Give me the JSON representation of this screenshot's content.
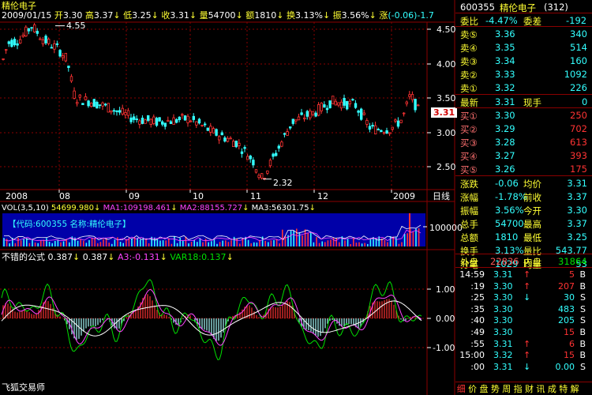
{
  "stock": {
    "name": "精伦电子",
    "code": "600355",
    "title_right": "精伦电子",
    "code_paren": "(312)"
  },
  "quote_bar": {
    "date": "2009/01/15",
    "open_label": "开",
    "open": "3.30",
    "high_label": "高",
    "high": "3.37",
    "low_label": "低",
    "low": "3.25",
    "close_label": "收",
    "close": "3.31",
    "vol_label": "量",
    "vol": "54700",
    "amt_label": "额",
    "amt": "1810",
    "turn_label": "换",
    "turn": "3.13%",
    "amp_label": "振",
    "amp": "3.56%",
    "chg_label": "涨",
    "chg": "(-0.06)-1.7"
  },
  "price_chart": {
    "y_ticks": [
      "4.50",
      "4.00",
      "3.50",
      "3.00",
      "2.50"
    ],
    "x_ticks": [
      "2008",
      "08",
      "09",
      "10",
      "11",
      "12",
      "2009"
    ],
    "x_axis_name": "日线",
    "current_price": "3.31",
    "high_marker": "4.55",
    "low_marker": "2.32"
  },
  "vol_header": {
    "label": "VOL(3,5,10)",
    "v1": "54699.980",
    "v1_label": "MA1:",
    "ma1": "109198.461",
    "ma2_label": "MA2:",
    "ma2": "88155.727",
    "ma3_label": "MA3:",
    "ma3": "56301.75"
  },
  "vol_chart": {
    "info_box": "【代码:600355 名称:精伦电子】",
    "y_tick": "100000"
  },
  "indicator": {
    "name": "不错的公式",
    "v1": "0.387",
    "v2": "0.387",
    "a3_label": "A3:",
    "a3": "-0.131",
    "var18_label": "VAR18:",
    "var18": "0.137",
    "y_ticks": [
      "1.00",
      "0.00",
      "-1.00"
    ],
    "watermark": "飞狐交易师"
  },
  "order_book": {
    "ratio_label": "委比",
    "ratio": "-4.47%",
    "diff_label": "委差",
    "diff": "-192",
    "asks": [
      {
        "label": "卖⑤",
        "price": "3.36",
        "vol": "340"
      },
      {
        "label": "卖④",
        "price": "3.35",
        "vol": "514"
      },
      {
        "label": "卖③",
        "price": "3.34",
        "vol": "160"
      },
      {
        "label": "卖②",
        "price": "3.33",
        "vol": "1092"
      },
      {
        "label": "卖①",
        "price": "3.32",
        "vol": "226"
      }
    ],
    "last_label": "最新",
    "last": "3.31",
    "cur_hand_label": "现手",
    "cur_hand": "0",
    "bids": [
      {
        "label": "买①",
        "price": "3.30",
        "vol": "250"
      },
      {
        "label": "买②",
        "price": "3.29",
        "vol": "702"
      },
      {
        "label": "买③",
        "price": "3.28",
        "vol": "613"
      },
      {
        "label": "买④",
        "price": "3.27",
        "vol": "393"
      },
      {
        "label": "买⑤",
        "price": "3.26",
        "vol": "175"
      }
    ]
  },
  "stats": [
    {
      "l1": "涨跌",
      "v1": "-0.06",
      "l2": "均价",
      "v2": "3.31"
    },
    {
      "l1": "涨幅",
      "v1": "-1.78%",
      "l2": "前收",
      "v2": "3.37"
    },
    {
      "l1": "振幅",
      "v1": "3.56%",
      "l2": "今开",
      "v2": "3.30"
    },
    {
      "l1": "总手",
      "v1": "54700",
      "l2": "最高",
      "v2": "3.37"
    },
    {
      "l1": "总额",
      "v1": "1810",
      "l2": "最低",
      "v2": "3.25"
    },
    {
      "l1": "换手",
      "v1": "3.13%",
      "l2": "量比",
      "v2": "543.77"
    },
    {
      "l1": "分笔",
      "v1": "1029",
      "l2": "均量",
      "v2": "53"
    }
  ],
  "outer_inner": {
    "outer_label": "外盘",
    "outer": "22836",
    "inner_label": "内盘",
    "inner": "31864"
  },
  "ticks": [
    {
      "time": "14:59",
      "price": "3.31",
      "arrow": "↑",
      "vol": "5",
      "side": "B"
    },
    {
      "time": ":19",
      "price": "3.30",
      "arrow": "↑",
      "vol": "207",
      "side": "B"
    },
    {
      "time": ":25",
      "price": "3.30",
      "arrow": "↓",
      "vol": "30",
      "side": "S"
    },
    {
      "time": ":35",
      "price": "3.30",
      "arrow": "",
      "vol": "483",
      "side": "S"
    },
    {
      "time": ":40",
      "price": "3.30",
      "arrow": "",
      "vol": "205",
      "side": "S"
    },
    {
      "time": ":49",
      "price": "3.30",
      "arrow": "",
      "vol": "15",
      "side": "B"
    },
    {
      "time": ":55",
      "price": "3.31",
      "arrow": "↑",
      "vol": "6",
      "side": "B"
    },
    {
      "time": "15:00",
      "price": "3.32",
      "arrow": "↑",
      "vol": "15",
      "side": "B"
    },
    {
      "time": ":00",
      "price": "3.31",
      "arrow": "↓",
      "vol": "0.00",
      "side": "S"
    }
  ],
  "tabs": [
    "细",
    "价",
    "盘",
    "势",
    "周",
    "指",
    "财",
    "讯",
    "成",
    "特",
    "解"
  ],
  "colors": {
    "up": "#ff3333",
    "down": "#33ffff",
    "grid": "#8b0000",
    "label": "#ffff33",
    "panel_bg": "#000000",
    "info_box_bg": "#0000a8"
  }
}
